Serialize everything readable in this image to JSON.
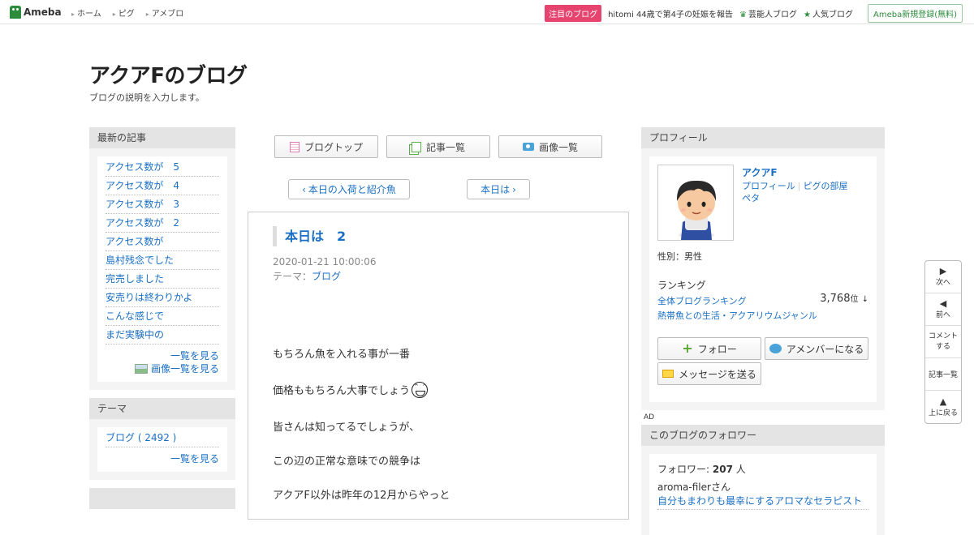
{
  "header": {
    "logo": "Ameba",
    "nav": [
      "ホーム",
      "ピグ",
      "アメブロ"
    ],
    "featured_badge": "注目のブログ",
    "featured_text": "hitomi 44歳で第4子の妊娠を報告",
    "celebrity_blog": "芸能人ブログ",
    "popular_blog": "人気ブログ",
    "register": "Ameba新規登録(無料)"
  },
  "blog": {
    "title": "アクアFのブログ",
    "description": "ブログの説明を入力します。"
  },
  "left": {
    "latest_heading": "最新の記事",
    "articles": [
      "アクセス数が　5",
      "アクセス数が　4",
      "アクセス数が　3",
      "アクセス数が　2",
      "アクセス数が",
      "島村残念でした",
      "完売しました",
      "安売りは終わりかよ",
      "こんな感じで",
      "まだ実験中の"
    ],
    "see_all": "一覧を見る",
    "image_list": "画像一覧を見る",
    "theme_heading": "テーマ",
    "themes": [
      "ブログ ( 2492 )"
    ],
    "theme_see_all": "一覧を見る"
  },
  "center": {
    "buttons": {
      "top": "ブログトップ",
      "articles": "記事一覧",
      "images": "画像一覧"
    },
    "prev": "本日の入荷と紹介魚",
    "next": "本日は",
    "entry": {
      "title": "本日は　2",
      "date": "2020-01-21 10:00:06",
      "theme_label": "テーマ：",
      "theme": "ブログ",
      "lines": [
        "もちろん魚を入れる事が一番",
        "価格ももちろん大事でしょう",
        "皆さんは知ってるでしょうが、",
        "この辺の正常な意味での競争は",
        "アクアF以外は昨年の12月からやっと"
      ]
    }
  },
  "right": {
    "profile_heading": "プロフィール",
    "name": "アクアF",
    "links": [
      "プロフィール",
      "ピグの部屋"
    ],
    "peta": "ペタ",
    "gender": "性別：男性",
    "ranking_label": "ランキング",
    "ranking_overall": "全体ブログランキング",
    "rank_value": "3,768",
    "rank_unit": "位",
    "rank_arrow": "↓",
    "ranking_genre": "熱帯魚との生活・アクアリウムジャンル",
    "follow": "フォロー",
    "member": "アメンバーになる",
    "message": "メッセージを送る",
    "ad": "AD",
    "followers_heading": "このブログのフォロワー",
    "followers_label": "フォロワー:",
    "followers_count": "207",
    "followers_unit": "人",
    "follower_name": "aroma-filerさん",
    "follower_blog": "自分もまわりも最幸にするアロマなセラピスト"
  },
  "float_nav": {
    "next": "次へ",
    "prev": "前へ",
    "comment": "コメントする",
    "list": "記事一覧",
    "top": "上に戻る"
  },
  "colors": {
    "link": "#1a6fc4",
    "brand": "#2d8c3c",
    "badge": "#e6436f"
  }
}
